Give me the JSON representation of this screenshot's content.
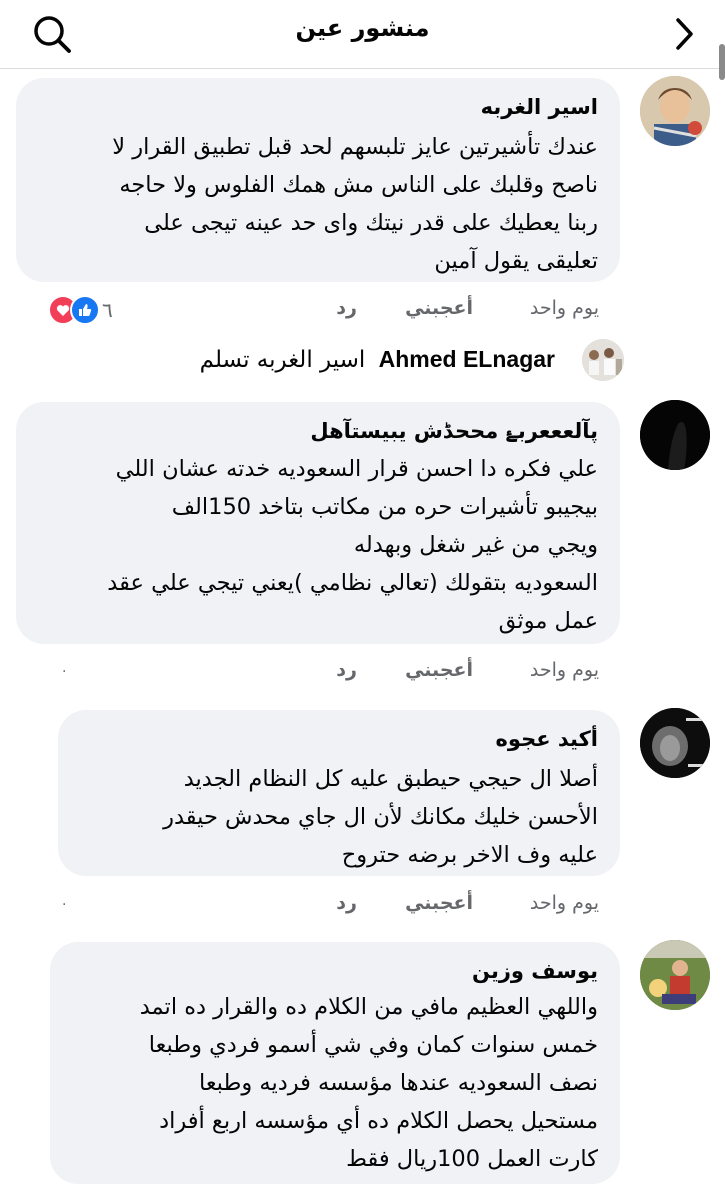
{
  "header": {
    "title": "منشور عين"
  },
  "comments": [
    {
      "author": "اسير الغربه",
      "lines": [
        "عندك تأشيرتين عايز تلبسهم لحد قبل تطبيق القرار لا",
        "ناصح وقلبك على الناس مش همك الفلوس ولا حاجه",
        "ربنا يعطيك على قدر نيتك واى حد عينه تيجى على",
        "تعليقى يقول آمين"
      ],
      "time": "يوم واحد",
      "like_label": "أعجبني",
      "reply_label": "رد",
      "reaction_count": "٦"
    },
    {
      "author": "پآلعععربۓ مححڈش يبيستآهل",
      "lines": [
        "علي فكره دا احسن قرار السعوديه خدته عشان اللي",
        "بيجيبو تأشيرات حره من مكاتب بتاخد 150الف",
        "ويجي من غير شغل وبهدله",
        "السعوديه بتقولك (تعالي نظامي )يعني تيجي علي عقد",
        "عمل موثق"
      ],
      "time": "يوم واحد",
      "like_label": "أعجبني",
      "reply_label": "رد"
    },
    {
      "author": "أكيد عجوه",
      "lines": [
        "أصلا ال حيجي حيطبق عليه كل النظام الجديد",
        "الأحسن خليك مكانك لأن ال جاي محدش حيقدر",
        "عليه وف الاخر برضه حتروح"
      ],
      "time": "يوم واحد",
      "like_label": "أعجبني",
      "reply_label": "رد"
    },
    {
      "author": "يوسف وزين",
      "lines": [
        "واللهي العظيم مافي من الكلام ده والقرار ده اتمد",
        "خمس سنوات كمان وفي شي أسمو فردي وطبعا",
        "نصف السعوديه عندها مؤسسه فرديه وطبعا",
        "مستحيل يحصل الكلام ده أي مؤسسه اربع أفراد",
        "كارت العمل 100ريال فقط"
      ]
    }
  ],
  "reply": {
    "author": "Ahmed ELnagar",
    "text": "اسير الغربه تسلم"
  },
  "dot_glyph": "·",
  "colors": {
    "bubble": "#f0f2f5",
    "meta": "#65676b",
    "like_blue": "#1877f2",
    "love_red": "#f33e58"
  }
}
